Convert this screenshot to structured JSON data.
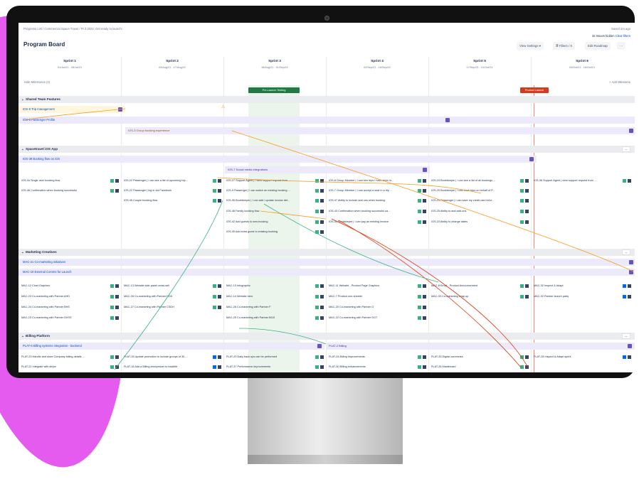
{
  "breadcrumb": "Programs List / Commercial Space Travel / PI 3 2022: Get ready to launch!",
  "page_title": "Program Board",
  "top_right": {
    "saved": "Saved 2m ago",
    "hidden": "32 Issues hidden",
    "clear_filters": "Clear filters"
  },
  "toolbar": {
    "view_settings": "View Settings ▾",
    "filters": "≣ Filters / 6",
    "edit_roadmap": "Edit Roadmap",
    "more": "···"
  },
  "sprints": [
    {
      "name": "Sprint 1",
      "dates": "01/Jul/21 - 28/Jul/21"
    },
    {
      "name": "Sprint 2",
      "dates": "03/Aug/21 - 17/Aug/21"
    },
    {
      "name": "Sprint 3",
      "dates": "18/Aug/21 - 01/Sep/21"
    },
    {
      "name": "Sprint 4",
      "dates": "02/Sep/21 - 16/Sep/21"
    },
    {
      "name": "Sprint 5",
      "dates": "17/Sep/21 - 01/Oct/21"
    },
    {
      "name": "Sprint 6",
      "dates": "04/Oct/21 - 18/Oct/21"
    }
  ],
  "milestones": {
    "toggle": "Hide Milestones (2)",
    "add": "+ Add Milestone",
    "pre_launch": "Pre-Launch Testing",
    "product_launch": "Product Launch"
  },
  "sections": {
    "shared": "Shared Team Features",
    "ios": "Spacetravel iOS App",
    "marketing": "Marketing Creatives",
    "billing": "Billing Platform"
  },
  "features": {
    "trip_mgmt": "IOS-8 Trip management",
    "passenger_profile": "IOS-5 Passenger Profile",
    "group_booking": "IOS-3 Group booking experience",
    "booking_flow": "IOS-39 Booking flow on iOS",
    "social_media": "IOS-7 Social media integrations",
    "comarketing": "MAC-21 Co-marketing initiatives",
    "external_comms": "MAC-10 External Comms for Launch",
    "billing_integration": "PLAT-6 Billing systems integration - backend",
    "billing_bar": "PLAT-2 Billing"
  },
  "ios_issues": [
    "IOS-44 Single user booking flow",
    "IOS-22 Passenger | I can see a list of upcoming trip...",
    "IOS-27 Support Agent | I view support request from ...",
    "IOS-8 Group Member | I can see trips I have been in...",
    "IOS-23 Bookkeeper | I can see a list of all bookings ...",
    "IOS-36 Support Agent | view support request from ...",
    "IOS-46 Confirmation when booking successful",
    "IOS-22 Passenger | log in via Facebook",
    "IOS-9 Passenger | I can switch an existing booking ...",
    "IOS-7 Group Member | I can accept a seat in a trip ...",
    "IOS-29 Bookkeeper | I can book trips on behalf of P...",
    "IOS-45 Couple booking flow",
    "IOS-35 Bookkeeper | I can add / update invoice det...",
    "IOS-47 Ability to include add ons when booking",
    "IOS-24 Passenger | I can save my credit card infor...",
    "IOS-48 Family booking flow",
    "IOS-43 Confirmation when booking successful ua...",
    "IOS-25 Ability to add add-ons",
    "IOS-42 Add guests to new booking",
    "IOS-31 Bookkeeper | I can pay an existing invoice",
    "IOS-23 Ability to change dates",
    "IOS-45 Add extra guest to existing booking"
  ],
  "mac_issues": [
    "MAC-12 Cinet Graphics",
    "MAC-13 Website side panel cross-sell",
    "MAC-13 Infographic",
    "MAC-11 Website - Product Page Graphics",
    "MAC-8 Email - Product Announcement",
    "MAC-32 Inspect & Adapt",
    "MAC-23 Co-marketing with Partner AHD",
    "MAC-28 Co-marketing with Partner DDD",
    "MAC-14 Website hero",
    "MAC-7 Product one-sheeter",
    "MAC-33 Co-marketing wrap up",
    "MAC-32 Partner launch party",
    "MAC-24 Co-marketing with Partner BHS",
    "MAC-27 Co-marketing with Partner CSDH",
    "MAC-26 Co-marketing with Partner F",
    "MAC-20 Co-marketing with Partner G",
    "MAC-23 Co-marketing with Partner DXSS",
    "MAC-25 Co-marketing with Partner BGS",
    "MAC-22 Co-marketing with Partner GGT"
  ],
  "plat_issues": [
    "PLAT-23 Handle and store Company billing details ...",
    "PLAT-15 Update promotion to include groups of 30 ...",
    "PLAT-20 Daily back ups can be performed",
    "PLAT-24 Billing Improvements",
    "PLAT-33 Digital currencies",
    "PLAT-28 Inspect & Adapt sprint",
    "PLAT-22 Integrate with stripe",
    "PLAT-16 Add a Billing anonymizer to backlife",
    "PLAT-37 Performance improvements",
    "PLAT-30 Billing enhancements",
    "PLAT-26 Mastercard"
  ],
  "colors": {
    "pre_launch": "#1f7a43",
    "product_launch": "#d63b20",
    "dependency_orange": "#ff991f",
    "dependency_red": "#de350b",
    "dependency_green": "#36b37e"
  }
}
